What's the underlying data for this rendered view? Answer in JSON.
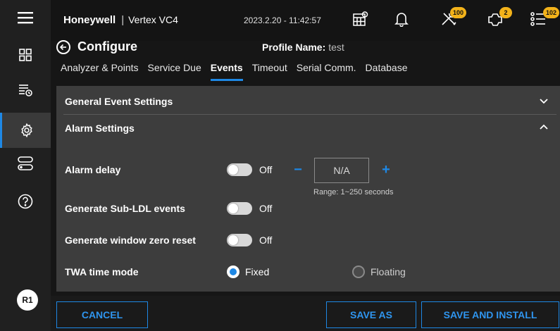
{
  "header": {
    "brand": "Honeywell",
    "separator": "|",
    "model": "Vertex VC4",
    "datetime": "2023.2.20 - 11:42:57",
    "badges": {
      "tools": "100",
      "sensor": "2",
      "list": "102"
    }
  },
  "sidebar": {
    "items": [
      {
        "icon": "dashboard-grid-icon"
      },
      {
        "icon": "event-list-icon"
      },
      {
        "icon": "settings-gear-icon",
        "active": true
      },
      {
        "icon": "storage-icon"
      },
      {
        "icon": "help-icon"
      }
    ],
    "user_initials": "R1"
  },
  "page": {
    "title": "Configure",
    "profile_label": "Profile Name:",
    "profile_value": "test"
  },
  "tabs": [
    {
      "label": "Analyzer & Points"
    },
    {
      "label": "Service Due"
    },
    {
      "label": "Events",
      "active": true
    },
    {
      "label": "Timeout"
    },
    {
      "label": "Serial Comm."
    },
    {
      "label": "Database"
    }
  ],
  "sections": {
    "general": {
      "title": "General Event Settings",
      "expanded": false
    },
    "alarm": {
      "title": "Alarm Settings",
      "expanded": true
    }
  },
  "alarm": {
    "delay_label": "Alarm delay",
    "delay_toggle": "Off",
    "delay_value": "N/A",
    "delay_minus": "−",
    "delay_plus": "+",
    "delay_range": "Range: 1~250 seconds",
    "sub_ldl_label": "Generate Sub-LDL events",
    "sub_ldl_toggle": "Off",
    "window_zero_label": "Generate window zero reset",
    "window_zero_toggle": "Off",
    "twa_label": "TWA time mode",
    "twa_options": [
      {
        "label": "Fixed",
        "selected": true
      },
      {
        "label": "Floating",
        "selected": false
      }
    ]
  },
  "footer": {
    "cancel": "CANCEL",
    "save_as": "SAVE AS",
    "save_install": "SAVE AND INSTALL"
  },
  "colors": {
    "accent": "#1e88e5",
    "badge": "#f2b21a",
    "panel": "#3d3d3d",
    "background": "#161616"
  }
}
